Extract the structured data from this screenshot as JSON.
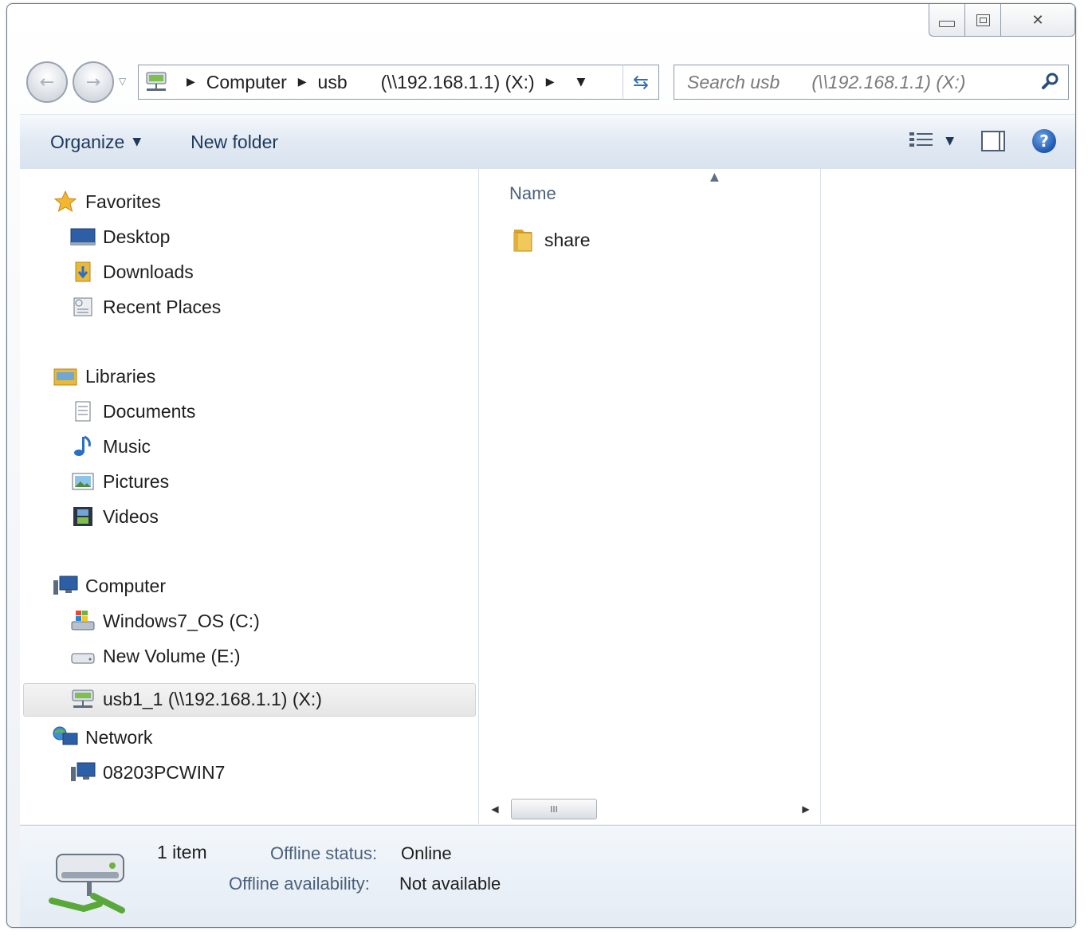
{
  "window": {
    "caption_buttons": {
      "minimize": "minimize-icon",
      "maximize": "maximize-icon",
      "close": "✕"
    }
  },
  "nav": {
    "back_glyph": "←",
    "forward_glyph": "→",
    "breadcrumb": [
      "Computer",
      "usb",
      "(\\\\192.168.1.1) (X:)"
    ],
    "refresh_glyph": "⇆"
  },
  "search": {
    "placeholder_1": "Search usb",
    "placeholder_2": "(\\\\192.168.1.1) (X:)"
  },
  "toolbar": {
    "organize_label": "Organize",
    "new_folder_label": "New folder",
    "help_glyph": "?"
  },
  "navpane": {
    "favorites": {
      "label": "Favorites",
      "items": [
        "Desktop",
        "Downloads",
        "Recent Places"
      ]
    },
    "libraries": {
      "label": "Libraries",
      "items": [
        "Documents",
        "Music",
        "Pictures",
        "Videos"
      ]
    },
    "computer": {
      "label": "Computer",
      "items": [
        "Windows7_OS (C:)",
        "New Volume (E:)",
        "usb1_1 (\\\\192.168.1.1) (X:)"
      ]
    },
    "network": {
      "label": "Network",
      "items": [
        "08203PCWIN7"
      ]
    }
  },
  "filelist": {
    "column_name": "Name",
    "items": [
      "share"
    ],
    "scroll_thumb": "III"
  },
  "details": {
    "item_count": "1 item",
    "offline_status_label": "Offline status:",
    "offline_status_value": "Online",
    "offline_availability_label": "Offline availability:",
    "offline_availability_value": "Not available"
  },
  "colors": {
    "accent": "#1e395b",
    "selection": "#e6e6e6",
    "folder": "#e8b93a"
  }
}
